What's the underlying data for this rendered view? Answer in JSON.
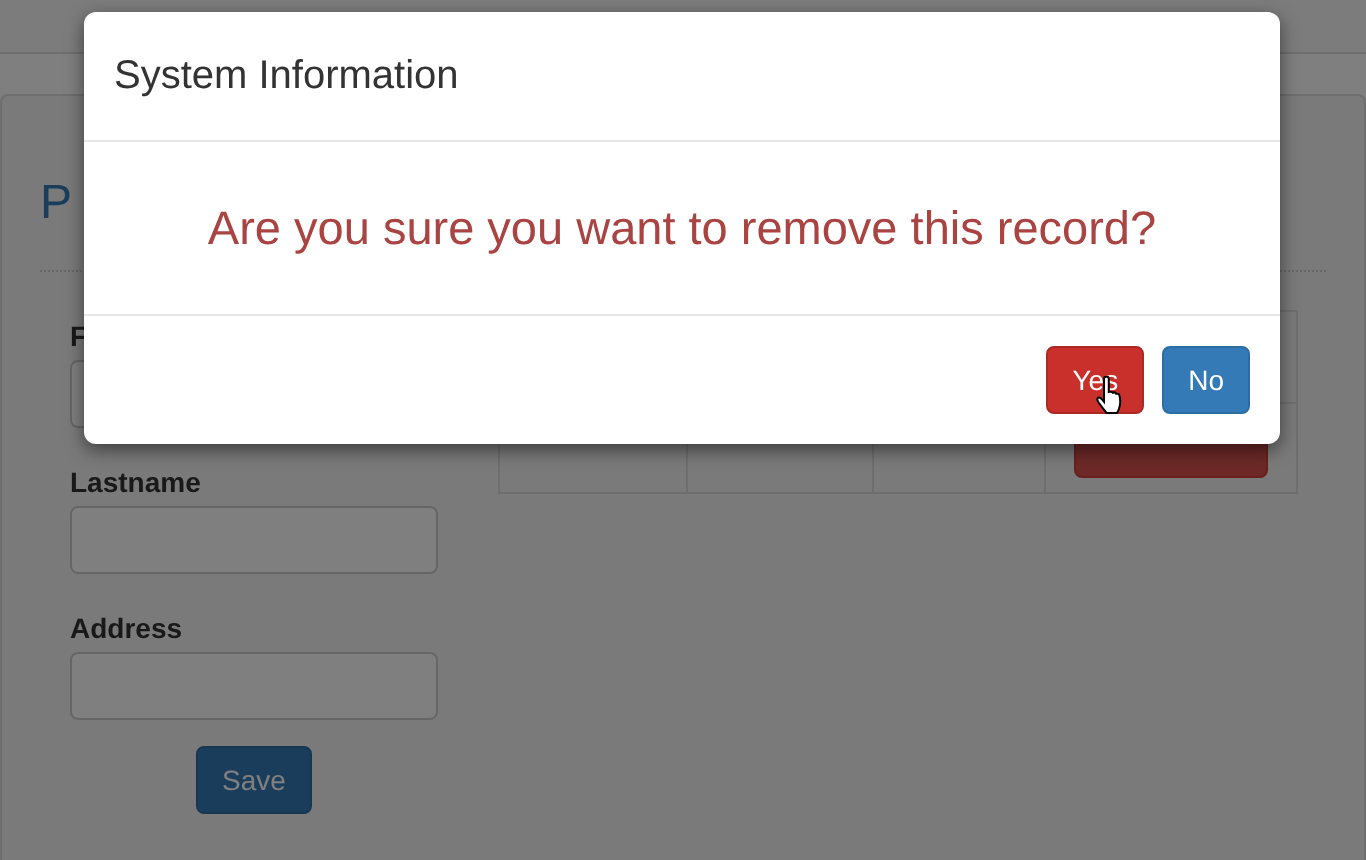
{
  "page": {
    "heading": "P",
    "fields": [
      {
        "label": "F"
      },
      {
        "label": "Lastname"
      },
      {
        "label": "Address"
      }
    ],
    "save_button": "Save"
  },
  "modal": {
    "title": "System Information",
    "message": "Are you sure you want to remove this record?",
    "buttons": [
      {
        "label": "Yes",
        "kind": "danger",
        "hovered": true
      },
      {
        "label": "No",
        "kind": "primary",
        "hovered": false
      }
    ]
  }
}
